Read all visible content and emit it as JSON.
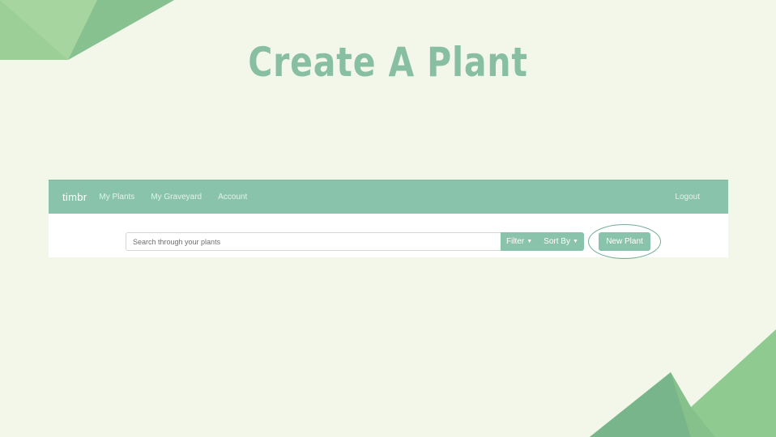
{
  "slide": {
    "title": "Create A Plant"
  },
  "app": {
    "navbar": {
      "brand": "timbr",
      "links": [
        "My Plants",
        "My Graveyard",
        "Account"
      ],
      "logout": "Logout"
    },
    "search": {
      "placeholder": "Search through your plants",
      "value": ""
    },
    "filter_label": "Filter",
    "sort_label": "Sort By",
    "new_plant_label": "New Plant"
  },
  "colors": {
    "accent": "#8ac3ac",
    "title": "#88bfa3",
    "background": "#f3f7ea"
  },
  "icons": {
    "caret": "caret-down-icon"
  }
}
